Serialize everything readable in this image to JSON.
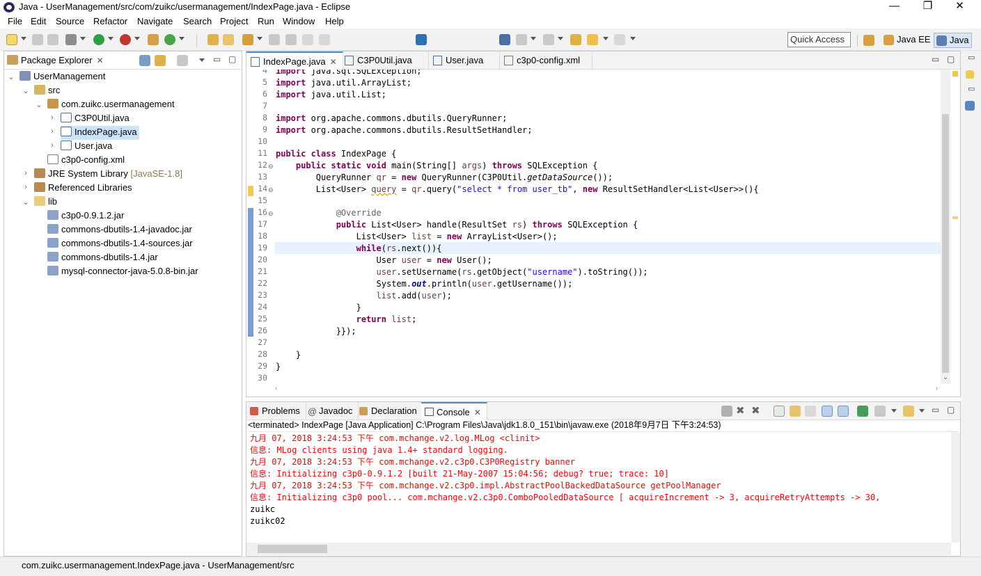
{
  "window": {
    "title": "Java - UserManagement/src/com/zuikc/usermanagement/IndexPage.java - Eclipse",
    "min": "—",
    "max": "❐",
    "close": "✕"
  },
  "menu": [
    "File",
    "Edit",
    "Source",
    "Refactor",
    "Navigate",
    "Search",
    "Project",
    "Run",
    "Window",
    "Help"
  ],
  "quick_access": "Quick Access",
  "perspectives": [
    "Java EE",
    "Java"
  ],
  "package_explorer": {
    "title": "Package Explorer",
    "items": [
      {
        "label": "UserManagement"
      },
      {
        "label": "src"
      },
      {
        "label": "com.zuikc.usermanagement"
      },
      {
        "label": "C3P0Util.java"
      },
      {
        "label": "IndexPage.java"
      },
      {
        "label": "User.java"
      },
      {
        "label": "c3p0-config.xml"
      },
      {
        "label": "JRE System Library",
        "extra": "[JavaSE-1.8]"
      },
      {
        "label": "Referenced Libraries"
      },
      {
        "label": "lib"
      },
      {
        "label": "c3p0-0.9.1.2.jar"
      },
      {
        "label": "commons-dbutils-1.4-javadoc.jar"
      },
      {
        "label": "commons-dbutils-1.4-sources.jar"
      },
      {
        "label": "commons-dbutils-1.4.jar"
      },
      {
        "label": "mysql-connector-java-5.0.8-bin.jar"
      }
    ]
  },
  "editor_tabs": [
    "IndexPage.java",
    "C3P0Util.java",
    "User.java",
    "c3p0-config.xml"
  ],
  "line_numbers": [
    "4",
    "5",
    "6",
    "7",
    "8",
    "9",
    "10",
    "11",
    "12",
    "13",
    "14",
    "15",
    "16",
    "17",
    "18",
    "19",
    "20",
    "21",
    "22",
    "23",
    "24",
    "25",
    "26",
    "27",
    "28",
    "29",
    "30"
  ],
  "code": {
    "l4a": "import ",
    "l4b": "java.sql.SQLException;",
    "l5a": "import ",
    "l5b": "java.util.ArrayList;",
    "l6a": "import ",
    "l6b": "java.util.List;",
    "l8a": "import ",
    "l8b": "org.apache.commons.dbutils.QueryRunner;",
    "l9a": "import ",
    "l9b": "org.apache.commons.dbutils.ResultSetHandler;",
    "l11a": "public class ",
    "l11b": "IndexPage {",
    "l12a": "    public static void ",
    "l12b": "main(String[] ",
    "l12c": "args",
    ") ": "",
    "l12d": ") ",
    "l12e": "throws ",
    "l12f": "SQLException {",
    "l13a": "        QueryRunner ",
    "l13b": "qr",
    " = ": "",
    "l13c": " = ",
    "l13d": "new ",
    "l13e": "QueryRunner(C3P0Util.",
    "l13f": "getDataSource",
    "l13g": "());",
    "l14a": "        List<User> ",
    "l14b": "query",
    " l14c": "",
    "l14c": " = ",
    "l14d": "qr",
    ".query(": "",
    "l14e": ".query(",
    "l14f": "\"select * from user_tb\"",
    "l14g": ", ",
    "l14h": "new ",
    "l14i": "ResultSetHandler<List<User>>(){",
    "l16a": "            ",
    "l16b": "@Override",
    "l17a": "            ",
    "l17b": "public ",
    "l17c": "List<User> handle(ResultSet ",
    "l17d": "rs",
    "l17e": ") ",
    "l17f": "throws ",
    "l17g": "SQLException {",
    "l18a": "                List<User> ",
    "l18b": "list",
    " l18c": "",
    "l18c": " = ",
    "l18d": "new ",
    "l18e": "ArrayList<User>();",
    "l19a": "                ",
    "l19b": "while",
    "l19c": "(",
    "l19d": "rs",
    ".next()){": "",
    "l19e": ".next()){",
    "l20a": "                    User ",
    "l20b": "user",
    " l20c": "",
    "l20c": " = ",
    "l20d": "new ",
    "l20e": "User();",
    "l21a": "                    ",
    "l21b": "user",
    ".setUsername(": "",
    "l21c": ".setUsername(",
    "l21d": "rs",
    ".getObject(": "",
    "l21e": ".getObject(",
    "l21f": "\"username\"",
    "l21g": ").toString());",
    "l22a": "                    System.",
    "l22b": "out",
    ".println(": "",
    "l22c": ".println(",
    "l22d": "user",
    ".getUsername());": "",
    "l22e": ".getUsername());",
    "l23a": "                    ",
    "l23b": "list",
    ".add(": "",
    "l23c": ".add(",
    "l23d": "user",
    ");": "",
    "l23e": ");",
    "l24a": "                }",
    "l25a": "                ",
    "l25b": "return ",
    "l25c": "list",
    ";": "",
    "l25d": ";",
    "l26a": "            }});",
    "l28a": "    }",
    "l29a": "}"
  },
  "console_tabs": [
    "Problems",
    "Javadoc",
    "Declaration",
    "Console"
  ],
  "console_header": "<terminated> IndexPage [Java Application] C:\\Program Files\\Java\\jdk1.8.0_151\\bin\\javaw.exe (2018年9月7日 下午3:24:53)",
  "console_lines": [
    "九月 07, 2018 3:24:53 下午 com.mchange.v2.log.MLog <clinit>",
    "信息: MLog clients using java 1.4+ standard logging.",
    "九月 07, 2018 3:24:53 下午 com.mchange.v2.c3p0.C3P0Registry banner",
    "信息: Initializing c3p0-0.9.1.2 [built 21-May-2007 15:04:56; debug? true; trace: 10]",
    "九月 07, 2018 3:24:53 下午 com.mchange.v2.c3p0.impl.AbstractPoolBackedDataSource getPoolManager",
    "信息: Initializing c3p0 pool... com.mchange.v2.c3p0.ComboPooledDataSource [ acquireIncrement -> 3, acquireRetryAttempts -> 30,",
    "zuikc",
    "zuikc02"
  ],
  "status": "com.zuikc.usermanagement.IndexPage.java - UserManagement/src",
  "icons": [
    "java-app-icon",
    "project-icon",
    "package-icon",
    "java-file-icon",
    "xml-file-icon",
    "library-icon",
    "folder-icon",
    "jar-icon",
    "console-icon"
  ]
}
